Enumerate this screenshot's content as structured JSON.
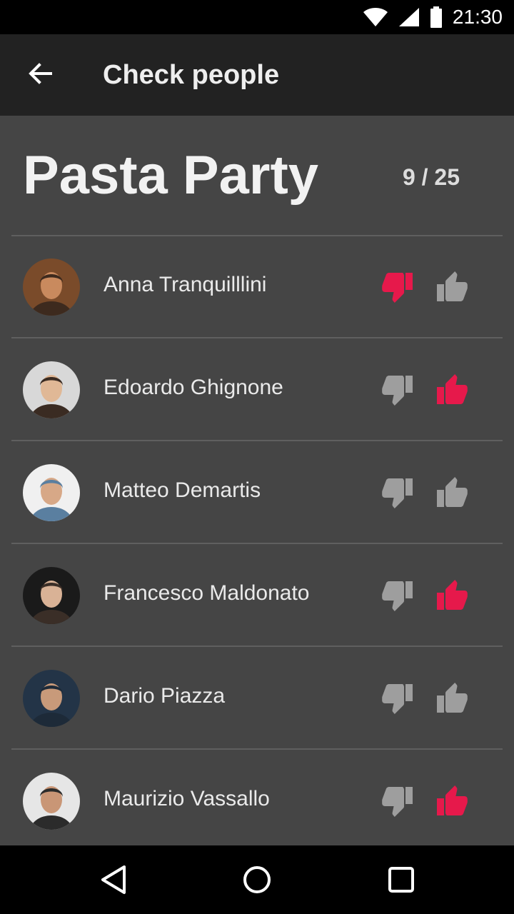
{
  "status_bar": {
    "time": "21:30",
    "icons": [
      "wifi-icon",
      "cell-signal-icon",
      "battery-icon"
    ]
  },
  "app_bar": {
    "title": "Check people",
    "back_icon": "arrow-back-icon"
  },
  "event": {
    "title": "Pasta Party",
    "counter": "9 / 25"
  },
  "colors": {
    "accent": "#e6194b",
    "inactive": "#9e9e9e",
    "background": "#454545",
    "app_bar": "#222222"
  },
  "people": [
    {
      "name": "Anna Tranquilllini",
      "vote": "down"
    },
    {
      "name": "Edoardo Ghignone",
      "vote": "up"
    },
    {
      "name": "Matteo Demartis",
      "vote": "none"
    },
    {
      "name": "Francesco Maldonato",
      "vote": "up"
    },
    {
      "name": "Dario Piazza",
      "vote": "none"
    },
    {
      "name": "Maurizio Vassallo",
      "vote": "up"
    }
  ],
  "nav": {
    "buttons": [
      "back-triangle-icon",
      "home-circle-icon",
      "recents-square-icon"
    ]
  }
}
